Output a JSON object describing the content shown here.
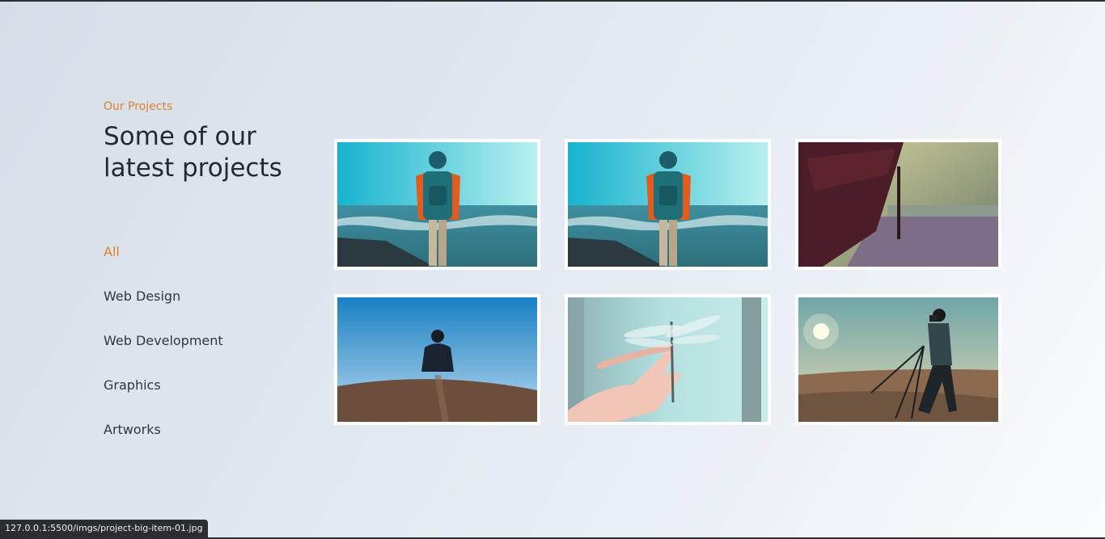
{
  "section": {
    "eyebrow": "Our Projects",
    "heading": "Some of our latest projects"
  },
  "filters": [
    {
      "label": "All",
      "active": true
    },
    {
      "label": "Web Design"
    },
    {
      "label": "Web Development"
    },
    {
      "label": "Graphics"
    },
    {
      "label": "Artworks"
    }
  ],
  "projects": [
    {
      "subject": "person-with-backpack-at-seashore"
    },
    {
      "subject": "person-with-backpack-at-seashore"
    },
    {
      "subject": "rusty-shipwreck-on-beach"
    },
    {
      "subject": "person-crouching-on-hilltop"
    },
    {
      "subject": "hand-with-dragonfly"
    },
    {
      "subject": "photographer-with-tripod"
    }
  ],
  "status_bar": {
    "url": "127.0.0.1:5500/imgs/project-big-item-01.jpg"
  },
  "colors": {
    "accent": "#e07f2e",
    "text": "#232a33"
  }
}
